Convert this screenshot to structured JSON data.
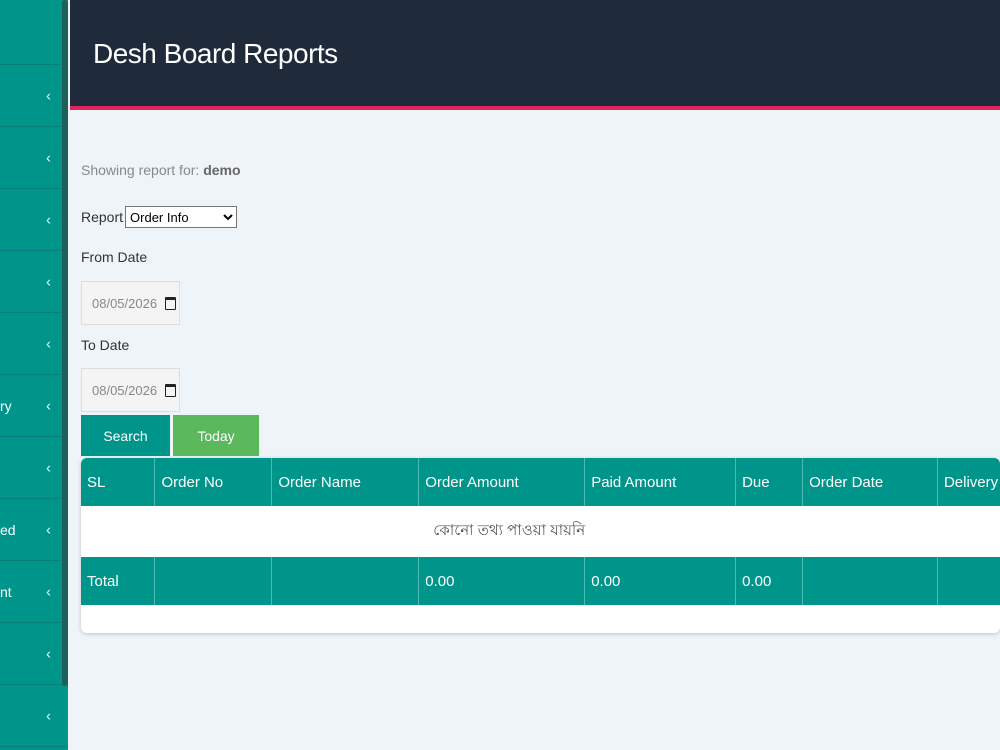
{
  "header": {
    "title": "Desh Board Reports"
  },
  "sidebar": {
    "items": [
      {
        "label": ""
      },
      {
        "label": ""
      },
      {
        "label": ""
      },
      {
        "label": ""
      },
      {
        "label": ""
      },
      {
        "label": "ry"
      },
      {
        "label": ""
      },
      {
        "label": "ed"
      },
      {
        "label": "nt"
      },
      {
        "label": ""
      },
      {
        "label": ""
      }
    ],
    "chevron": "‹"
  },
  "report": {
    "showing_prefix": "Showing report for:",
    "showing_user": "demo",
    "report_label": "Report",
    "report_selected": "Order Info",
    "from_label": "From Date",
    "from_value": "08/05/2026",
    "to_label": "To Date",
    "to_value": "08/05/2026",
    "search_label": "Search",
    "today_label": "Today"
  },
  "table": {
    "headers": [
      "SL",
      "Order No",
      "Order Name",
      "Order Amount",
      "Paid Amount",
      "Due",
      "Order Date",
      "Delivery Da"
    ],
    "empty_message": "কোনো তথ্য পাওয়া যায়নি",
    "total": {
      "label": "Total",
      "order_amount": "0.00",
      "paid_amount": "0.00",
      "due": "0.00"
    }
  },
  "colors": {
    "teal": "#00958a",
    "header_bg": "#1f2b3a",
    "accent_border": "#e0245a",
    "green": "#5cb85c"
  }
}
